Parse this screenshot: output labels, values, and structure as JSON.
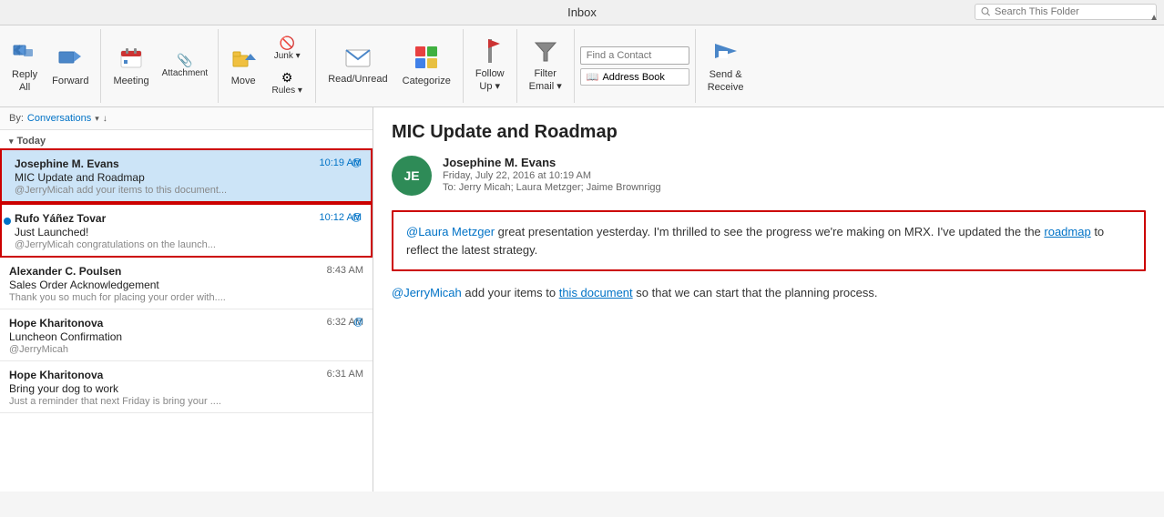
{
  "title_bar": {
    "title": "Inbox",
    "search_placeholder": "Search This Folder",
    "scroll_label": "▲"
  },
  "ribbon": {
    "groups": [
      {
        "name": "respond",
        "buttons": [
          {
            "id": "reply-all",
            "icon": "↩",
            "label": "Reply\nAll",
            "has_dropdown": false
          },
          {
            "id": "forward",
            "icon": "↪",
            "label": "Forward",
            "has_dropdown": false
          }
        ]
      },
      {
        "name": "new",
        "buttons": [
          {
            "id": "meeting",
            "icon": "📅",
            "label": "Meeting",
            "has_dropdown": false
          },
          {
            "id": "attachment",
            "icon": "📎",
            "label": "Attachment",
            "has_dropdown": false
          }
        ]
      },
      {
        "name": "actions",
        "buttons": [
          {
            "id": "move",
            "icon": "📁",
            "label": "Move",
            "has_dropdown": false
          },
          {
            "id": "junk",
            "icon": "🚫",
            "label": "Junk",
            "has_dropdown": true
          },
          {
            "id": "rules",
            "icon": "⚙",
            "label": "Rules",
            "has_dropdown": true
          }
        ]
      },
      {
        "name": "read",
        "buttons": [
          {
            "id": "read-unread",
            "icon": "✉",
            "label": "Read/Unread",
            "has_dropdown": false
          },
          {
            "id": "categorize",
            "icon": "🔶",
            "label": "Categorize",
            "has_dropdown": false
          }
        ]
      },
      {
        "name": "follow",
        "buttons": [
          {
            "id": "follow-up",
            "icon": "🚩",
            "label": "Follow\nUp",
            "has_dropdown": true
          }
        ]
      },
      {
        "name": "filter",
        "buttons": [
          {
            "id": "filter-email",
            "icon": "▽",
            "label": "Filter\nEmail",
            "has_dropdown": true
          }
        ]
      },
      {
        "name": "find",
        "find_contact_placeholder": "Find a Contact",
        "address_book_label": "Address Book",
        "address_book_icon": "📖"
      },
      {
        "name": "send-receive",
        "buttons": [
          {
            "id": "send-receive",
            "icon": "⇄",
            "label": "Send &\nReceive",
            "has_dropdown": false
          }
        ]
      }
    ]
  },
  "email_list": {
    "sort_label": "By:",
    "sort_value": "Conversations",
    "sort_direction": "↓",
    "group_header": "Today",
    "items": [
      {
        "id": "email-1",
        "sender": "Josephine M. Evans",
        "subject": "MIC Update and Roadmap",
        "preview": "@JerryMicah add your items to this document...",
        "time": "10:19 AM",
        "time_color": "blue",
        "unread": false,
        "selected": true,
        "has_at": true
      },
      {
        "id": "email-2",
        "sender": "Rufo Yáñez Tovar",
        "subject": "Just Launched!",
        "preview": "@JerryMicah congratulations on the launch...",
        "time": "10:12 AM",
        "time_color": "blue",
        "unread": true,
        "selected": false,
        "has_at": true
      },
      {
        "id": "email-3",
        "sender": "Alexander C. Poulsen",
        "subject": "Sales Order Acknowledgement",
        "preview": "Thank you so much for placing your order with....",
        "time": "8:43 AM",
        "time_color": "gray",
        "unread": false,
        "selected": false,
        "has_at": false
      },
      {
        "id": "email-4",
        "sender": "Hope Kharitonova",
        "subject": "Luncheon Confirmation",
        "preview": "@JerryMicah",
        "time": "6:32 AM",
        "time_color": "gray",
        "unread": false,
        "selected": false,
        "has_at": true
      },
      {
        "id": "email-5",
        "sender": "Hope Kharitonova",
        "subject": "Bring your dog to work",
        "preview": "Just a reminder that next Friday is bring your ....",
        "time": "6:31 AM",
        "time_color": "gray",
        "unread": false,
        "selected": false,
        "has_at": false
      }
    ]
  },
  "reading_pane": {
    "email_subject": "MIC Update and Roadmap",
    "sender": "Josephine M. Evans",
    "avatar_initials": "JE",
    "avatar_color": "#2e8b57",
    "date": "Friday, July 22, 2016 at 10:19 AM",
    "to": "To: Jerry Micah; Laura Metzger; Jaime Brownrigg",
    "body_block": {
      "mention": "@Laura Metzger",
      "text1": " great presentation yesterday. I'm thrilled to see the progress we're making on MRX.  I've updated the the ",
      "link": "roadmap",
      "text2": " to reflect the latest strategy."
    },
    "body_line2": {
      "mention": "@JerryMicah",
      "text1": " add your items to ",
      "link": "this document",
      "text2": " so that we can start that the planning process."
    }
  }
}
